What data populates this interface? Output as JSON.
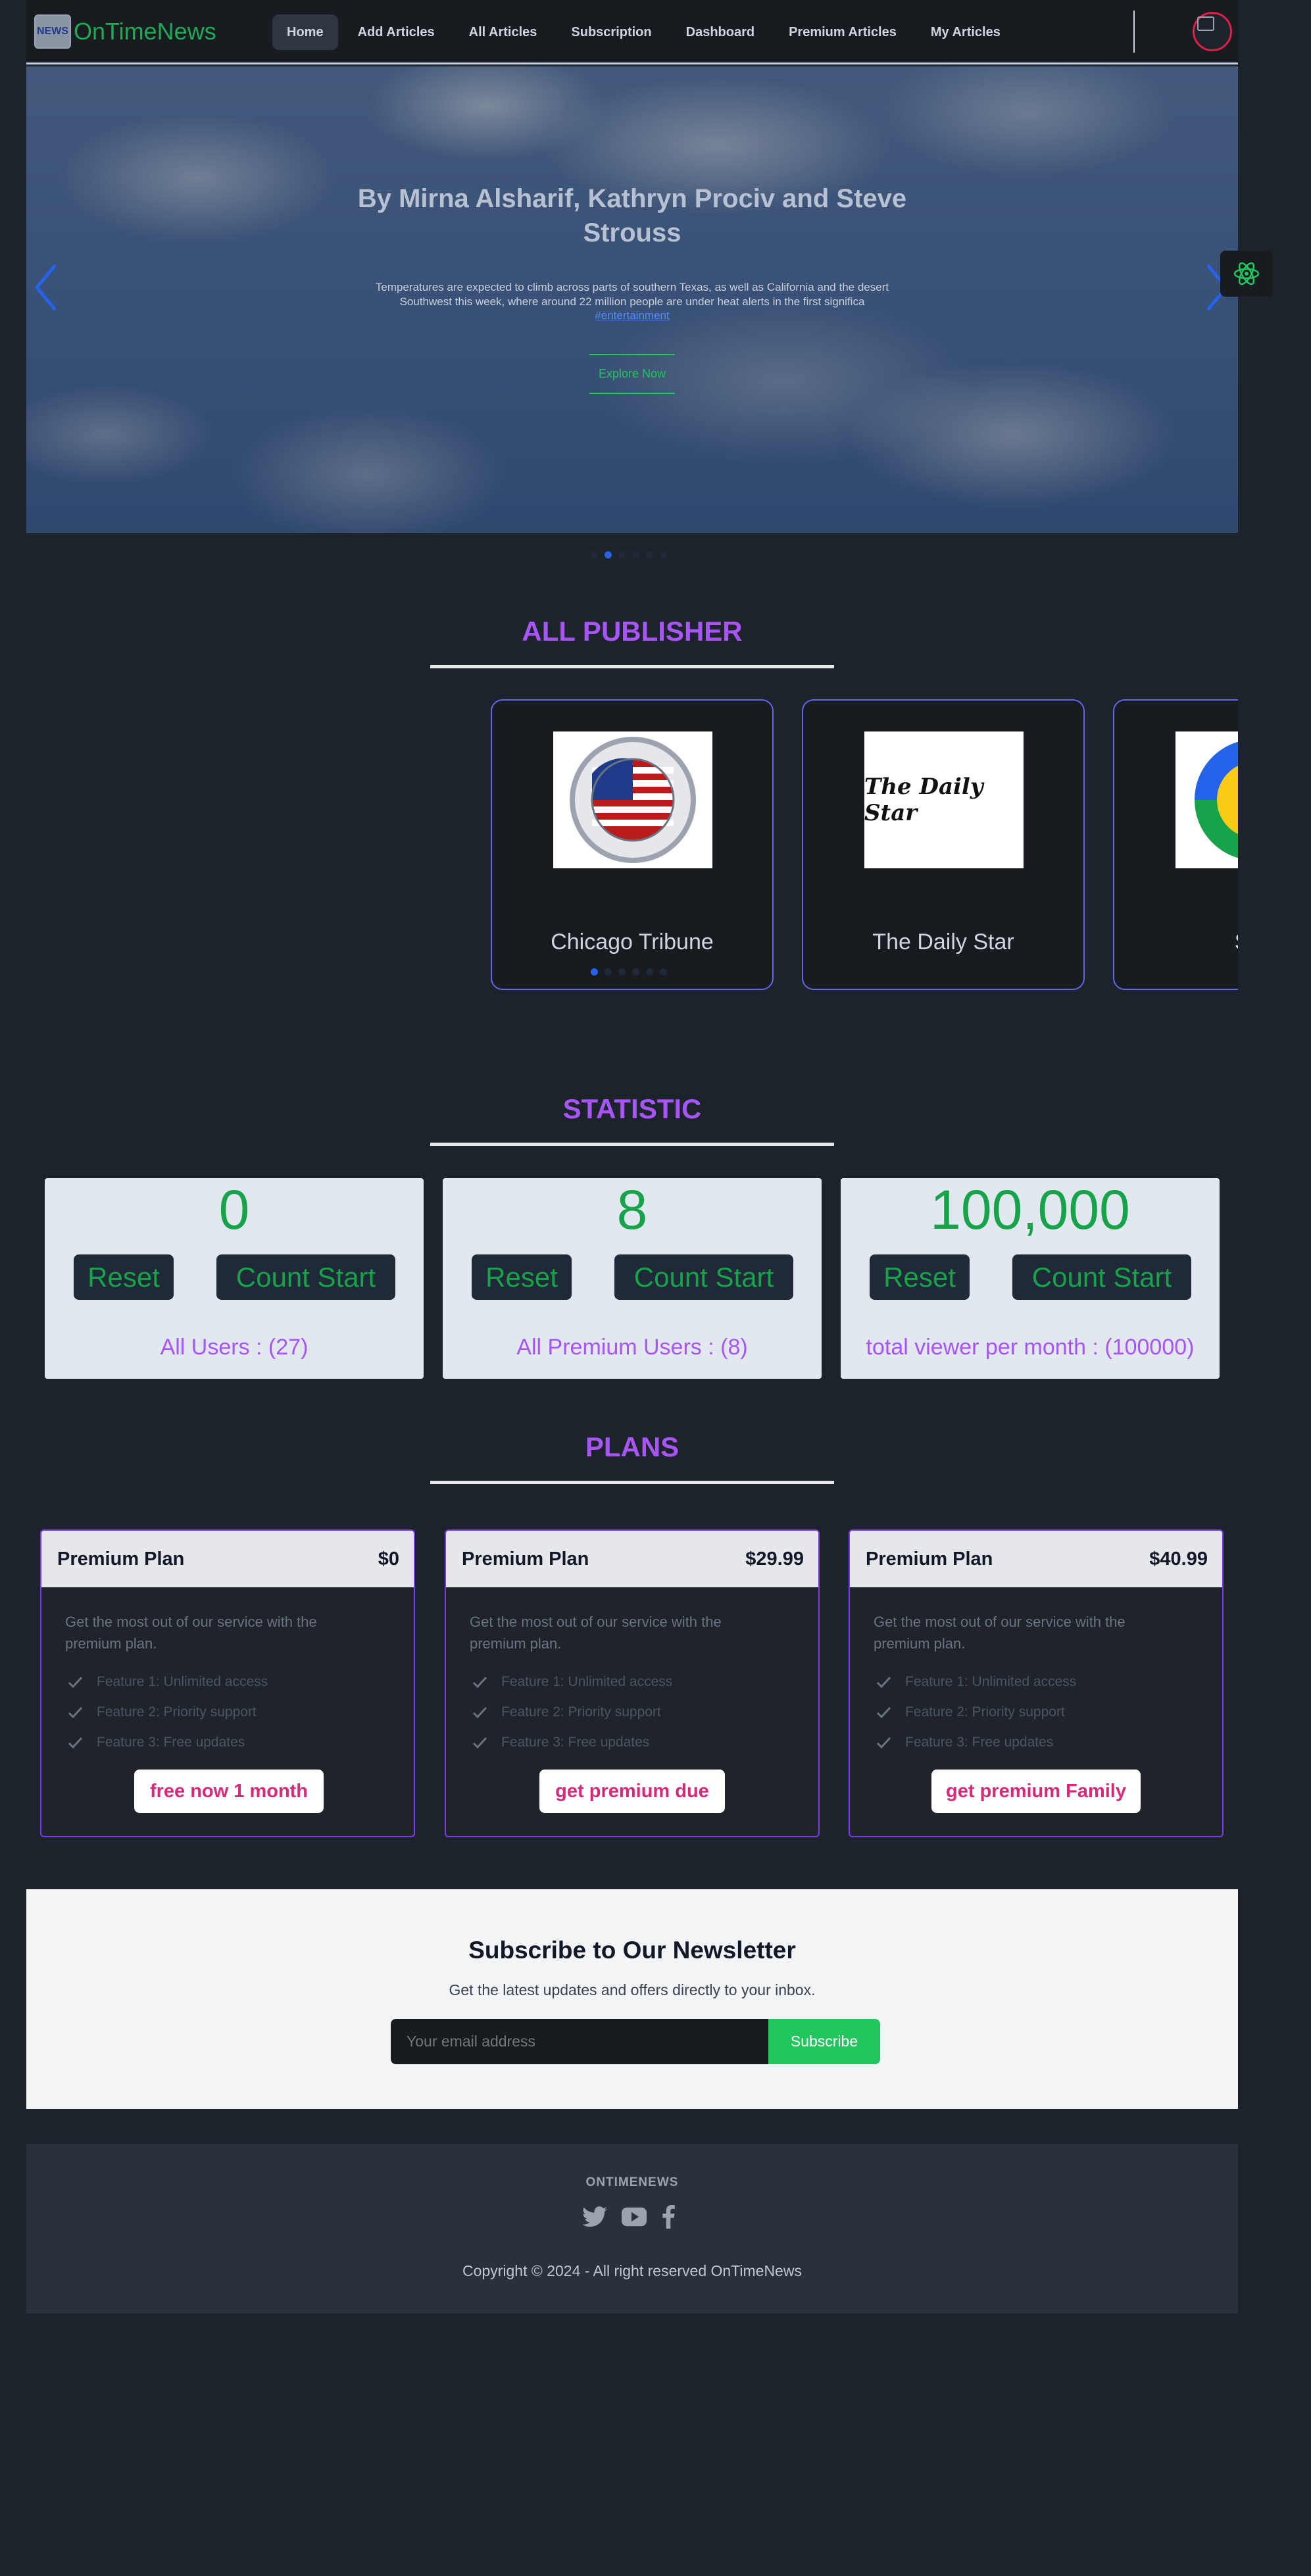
{
  "navbar": {
    "brand_logo_text": "NEWS",
    "brand_name": "OnTimeNews",
    "links": [
      {
        "label": "Home",
        "active": true
      },
      {
        "label": "Add Articles"
      },
      {
        "label": "All Articles"
      },
      {
        "label": "Subscription"
      },
      {
        "label": "Dashboard"
      },
      {
        "label": "Premium Articles"
      },
      {
        "label": "My Articles"
      }
    ],
    "avatar_icon": "broken-image-avatar-icon"
  },
  "hero": {
    "title": "By Mirna Alsharif, Kathryn Prociv and Steve Strouss",
    "text": "Temperatures are expected to climb across parts of southern Texas, as well as California and the desert Southwest this week, where around 22 million people are under heat alerts in the first significa",
    "tag": "#entertainment",
    "button_label": "Explore Now",
    "prev_icon": "chevron-left-icon",
    "next_icon": "chevron-right-icon",
    "slides_count": 6,
    "active_slide": 1
  },
  "publishers": {
    "title": "ALL PUBLISHER",
    "cards": [
      {
        "name": "Chicago Tribune",
        "logo": "alaska-seal-logo"
      },
      {
        "name": "The Daily Star",
        "logo_text": "The Daily Star"
      },
      {
        "name": "Spo",
        "logo": "colorful-circle-logo"
      }
    ],
    "dots_count": 6,
    "active_dot": 0
  },
  "statistic": {
    "title": "STATISTIC",
    "items": [
      {
        "value": "0",
        "reset_label": "Reset",
        "count_label": "Count Start",
        "label": "All Users : (27)"
      },
      {
        "value": "8",
        "reset_label": "Reset",
        "count_label": "Count Start",
        "label": "All Premium Users : (8)"
      },
      {
        "value": "100,000",
        "reset_label": "Reset",
        "count_label": "Count Start",
        "label": "total viewer per month : (100000)"
      }
    ]
  },
  "plans": {
    "title": "PLANS",
    "items": [
      {
        "name": "Premium Plan",
        "price": "$0",
        "description": "Get the most out of our service with the premium plan.",
        "features": [
          "Feature 1: Unlimited access",
          "Feature 2: Priority support",
          "Feature 3: Free updates"
        ],
        "button": "free now 1 month"
      },
      {
        "name": "Premium Plan",
        "price": "$29.99",
        "description": "Get the most out of our service with the premium plan.",
        "features": [
          "Feature 1: Unlimited access",
          "Feature 2: Priority support",
          "Feature 3: Free updates"
        ],
        "button": "get premium due"
      },
      {
        "name": "Premium Plan",
        "price": "$40.99",
        "description": "Get the most out of our service with the premium plan.",
        "features": [
          "Feature 1: Unlimited access",
          "Feature 2: Priority support",
          "Feature 3: Free updates"
        ],
        "button": "get premium Family"
      }
    ]
  },
  "newsletter": {
    "title": "Subscribe to Our Newsletter",
    "text": "Get the latest updates and offers directly to your inbox.",
    "placeholder": "Your email address",
    "button": "Subscribe"
  },
  "footer": {
    "brand": "ONTIMENEWS",
    "socials": [
      "twitter-icon",
      "youtube-icon",
      "facebook-icon"
    ],
    "copyright": "Copyright © 2024 - All right reserved OnTimeNews"
  },
  "colors": {
    "page_bg": "#1d232a",
    "brand_green": "#1faa55",
    "accent_purple": "#a855f7",
    "stat_green": "#16a34a",
    "plan_button_pink": "#db2777",
    "subscribe_green": "#22c55e",
    "carousel_blue": "#2563eb"
  }
}
